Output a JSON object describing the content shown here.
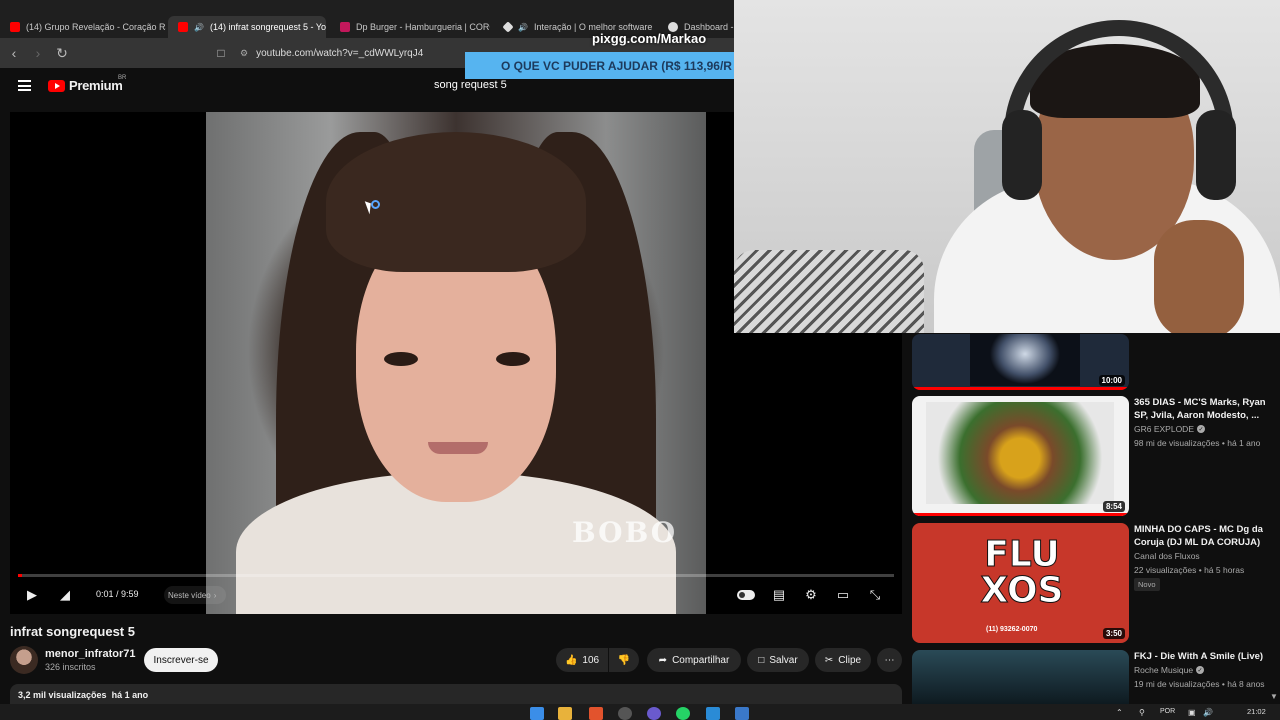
{
  "browser": {
    "tabs": [
      {
        "label": "(14) Grupo Revelação - Coração Rad",
        "color": "#ff0000",
        "active": false
      },
      {
        "label": "(14) infrat songrequest 5 - Yo",
        "color": "#ff0000",
        "active": true
      },
      {
        "label": "Dp Burger - Hamburgueria | CORONE",
        "color": "#c2185b",
        "active": false
      },
      {
        "label": "Interação | O melhor software pa",
        "color": "#dddddd",
        "active": false
      },
      {
        "label": "Dashboard - Li",
        "color": "#dddddd",
        "active": false
      }
    ],
    "url": "youtube.com/watch?v=_cdWWLyrqJ4"
  },
  "overlay": {
    "site": "pixgg.com/Markao",
    "banner": "O QUE VC PUDER AJUDAR (R$ 113,96/R"
  },
  "youtube": {
    "brand": "Premium",
    "region": "BR",
    "search_query": "song request 5"
  },
  "player": {
    "watermark": "BOBO",
    "time": "0:01 / 9:59",
    "chapter": "Neste vídeo",
    "progress_fraction": 0.0017
  },
  "video": {
    "title": "infrat songrequest 5",
    "channel": "menor_infrator71",
    "subscribers": "326 inscritos",
    "subscribe_label": "Inscrever-se",
    "likes": "106",
    "share_label": "Compartilhar",
    "save_label": "Salvar",
    "clip_label": "Clipe",
    "views": "3,2 mil visualizações",
    "uploaded": "há 1 ano"
  },
  "sidebar": [
    {
      "title": "",
      "channel": "",
      "meta": "",
      "duration": "10:00",
      "thumb_color": "#1f2a3a"
    },
    {
      "title": "365 DIAS - MC'S Marks, Ryan SP, Jvila, Aaron Modesto, ...",
      "channel": "GR6 EXPLODE",
      "verified": true,
      "meta": "98 mi de visualizações • há 1 ano",
      "duration": "8:54",
      "thumb_color": "#f2f2f2"
    },
    {
      "title": "MINHA DO CAPS - MC Dg da Coruja (DJ ML DA CORUJA)",
      "channel": "Canal dos Fluxos",
      "verified": false,
      "meta": "22 visualizações • há 5 horas",
      "badge": "Novo",
      "duration": "3:50",
      "thumb_color": "#c7372a",
      "thumb_text": "FLU XOS",
      "thumb_phone": "(11) 93262-0070"
    },
    {
      "title": "FKJ - Die With A Smile (Live)",
      "channel": "Roche Musique",
      "verified": true,
      "meta": "19 mi de visualizações • há 8 anos",
      "duration": "",
      "thumb_color": "#2a4a57"
    }
  ],
  "taskbar": {
    "lang": "POR",
    "time": "21:02"
  }
}
